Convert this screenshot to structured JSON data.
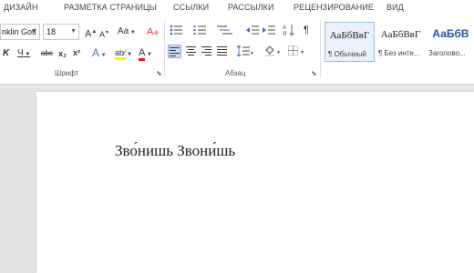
{
  "tabs": [
    "ДИЗАЙН",
    "РАЗМЕТКА СТРАНИЦЫ",
    "ССЫЛКИ",
    "РАССЫЛКИ",
    "РЕЦЕНЗИРОВАНИЕ",
    "ВИД"
  ],
  "font": {
    "name": "nklin Gotl",
    "size": "18",
    "group_label": "Шрифт",
    "grow_glyph": "A",
    "shrink_glyph": "A",
    "case_glyph": "Aa",
    "clear_glyph": "A",
    "italic_glyph": "K",
    "underline_glyph": "Ч",
    "strike_label": "abc",
    "subscript_glyph": "x₂",
    "superscript_glyph": "x²",
    "effects_glyph": "A",
    "highlight_glyph": "ab⁄",
    "font_color_glyph": "A"
  },
  "paragraph": {
    "group_label": "Абзац",
    "pilcrow": "¶"
  },
  "styles": [
    {
      "sample": "АаБбВвГ",
      "name": "¶ Обычный"
    },
    {
      "sample": "АаБбВвГ",
      "name": "¶ Без инте..."
    },
    {
      "sample": "АаБбВ",
      "name": "Заголово..."
    }
  ],
  "colors": {
    "heading_style": "#2e5396",
    "highlight": "#ffef00",
    "font_color": "#e81c23",
    "effects": "#4a7cc9"
  },
  "document": {
    "text": "Зво́нишь Звони́шь"
  }
}
